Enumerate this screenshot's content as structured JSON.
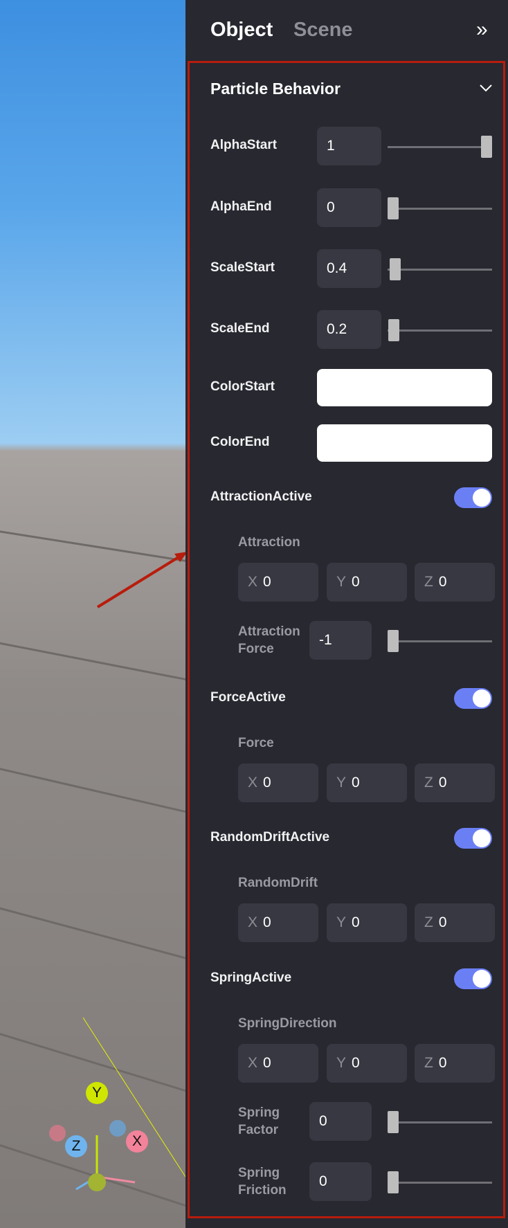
{
  "tabs": [
    {
      "label": "Object",
      "active": true
    },
    {
      "label": "Scene",
      "active": false
    }
  ],
  "section": {
    "title": "Particle Behavior",
    "expanded": true
  },
  "sliders": [
    {
      "label": "AlphaStart",
      "value": "1",
      "fraction": 1
    },
    {
      "label": "AlphaEnd",
      "value": "0",
      "fraction": 0
    },
    {
      "label": "ScaleStart",
      "value": "0.4",
      "fraction": 0.02
    },
    {
      "label": "ScaleEnd",
      "value": "0.2",
      "fraction": 0.01
    }
  ],
  "colors": [
    {
      "label": "ColorStart",
      "value": "#ffffff"
    },
    {
      "label": "ColorEnd",
      "value": "#ffffff"
    }
  ],
  "groups": [
    {
      "toggle": "AttractionActive",
      "on": true,
      "vector": "Attraction",
      "x": "0",
      "y": "0",
      "z": "0",
      "extra": {
        "label1": "Attraction",
        "label2": "Force",
        "value": "-1",
        "fraction": 0
      }
    },
    {
      "toggle": "ForceActive",
      "on": true,
      "vector": "Force",
      "x": "0",
      "y": "0",
      "z": "0"
    },
    {
      "toggle": "RandomDriftActive",
      "on": true,
      "vector": "RandomDrift",
      "x": "0",
      "y": "0",
      "z": "0"
    },
    {
      "toggle": "SpringActive",
      "on": true,
      "vector": "SpringDirection",
      "x": "0",
      "y": "0",
      "z": "0"
    }
  ],
  "spring": [
    {
      "label1": "Spring",
      "label2": "Factor",
      "value": "0",
      "fraction": 0
    },
    {
      "label1": "Spring",
      "label2": "Friction",
      "value": "0",
      "fraction": 0
    }
  ],
  "axes": {
    "x": "X",
    "y": "Y",
    "z": "Z"
  },
  "gizmo": {
    "x": "X",
    "y": "Y",
    "z": "Z"
  },
  "colors_accent": {
    "toggle": "#6b7ff5",
    "highlight": "#b81c0c",
    "panel": "#272830",
    "input": "#373841"
  }
}
